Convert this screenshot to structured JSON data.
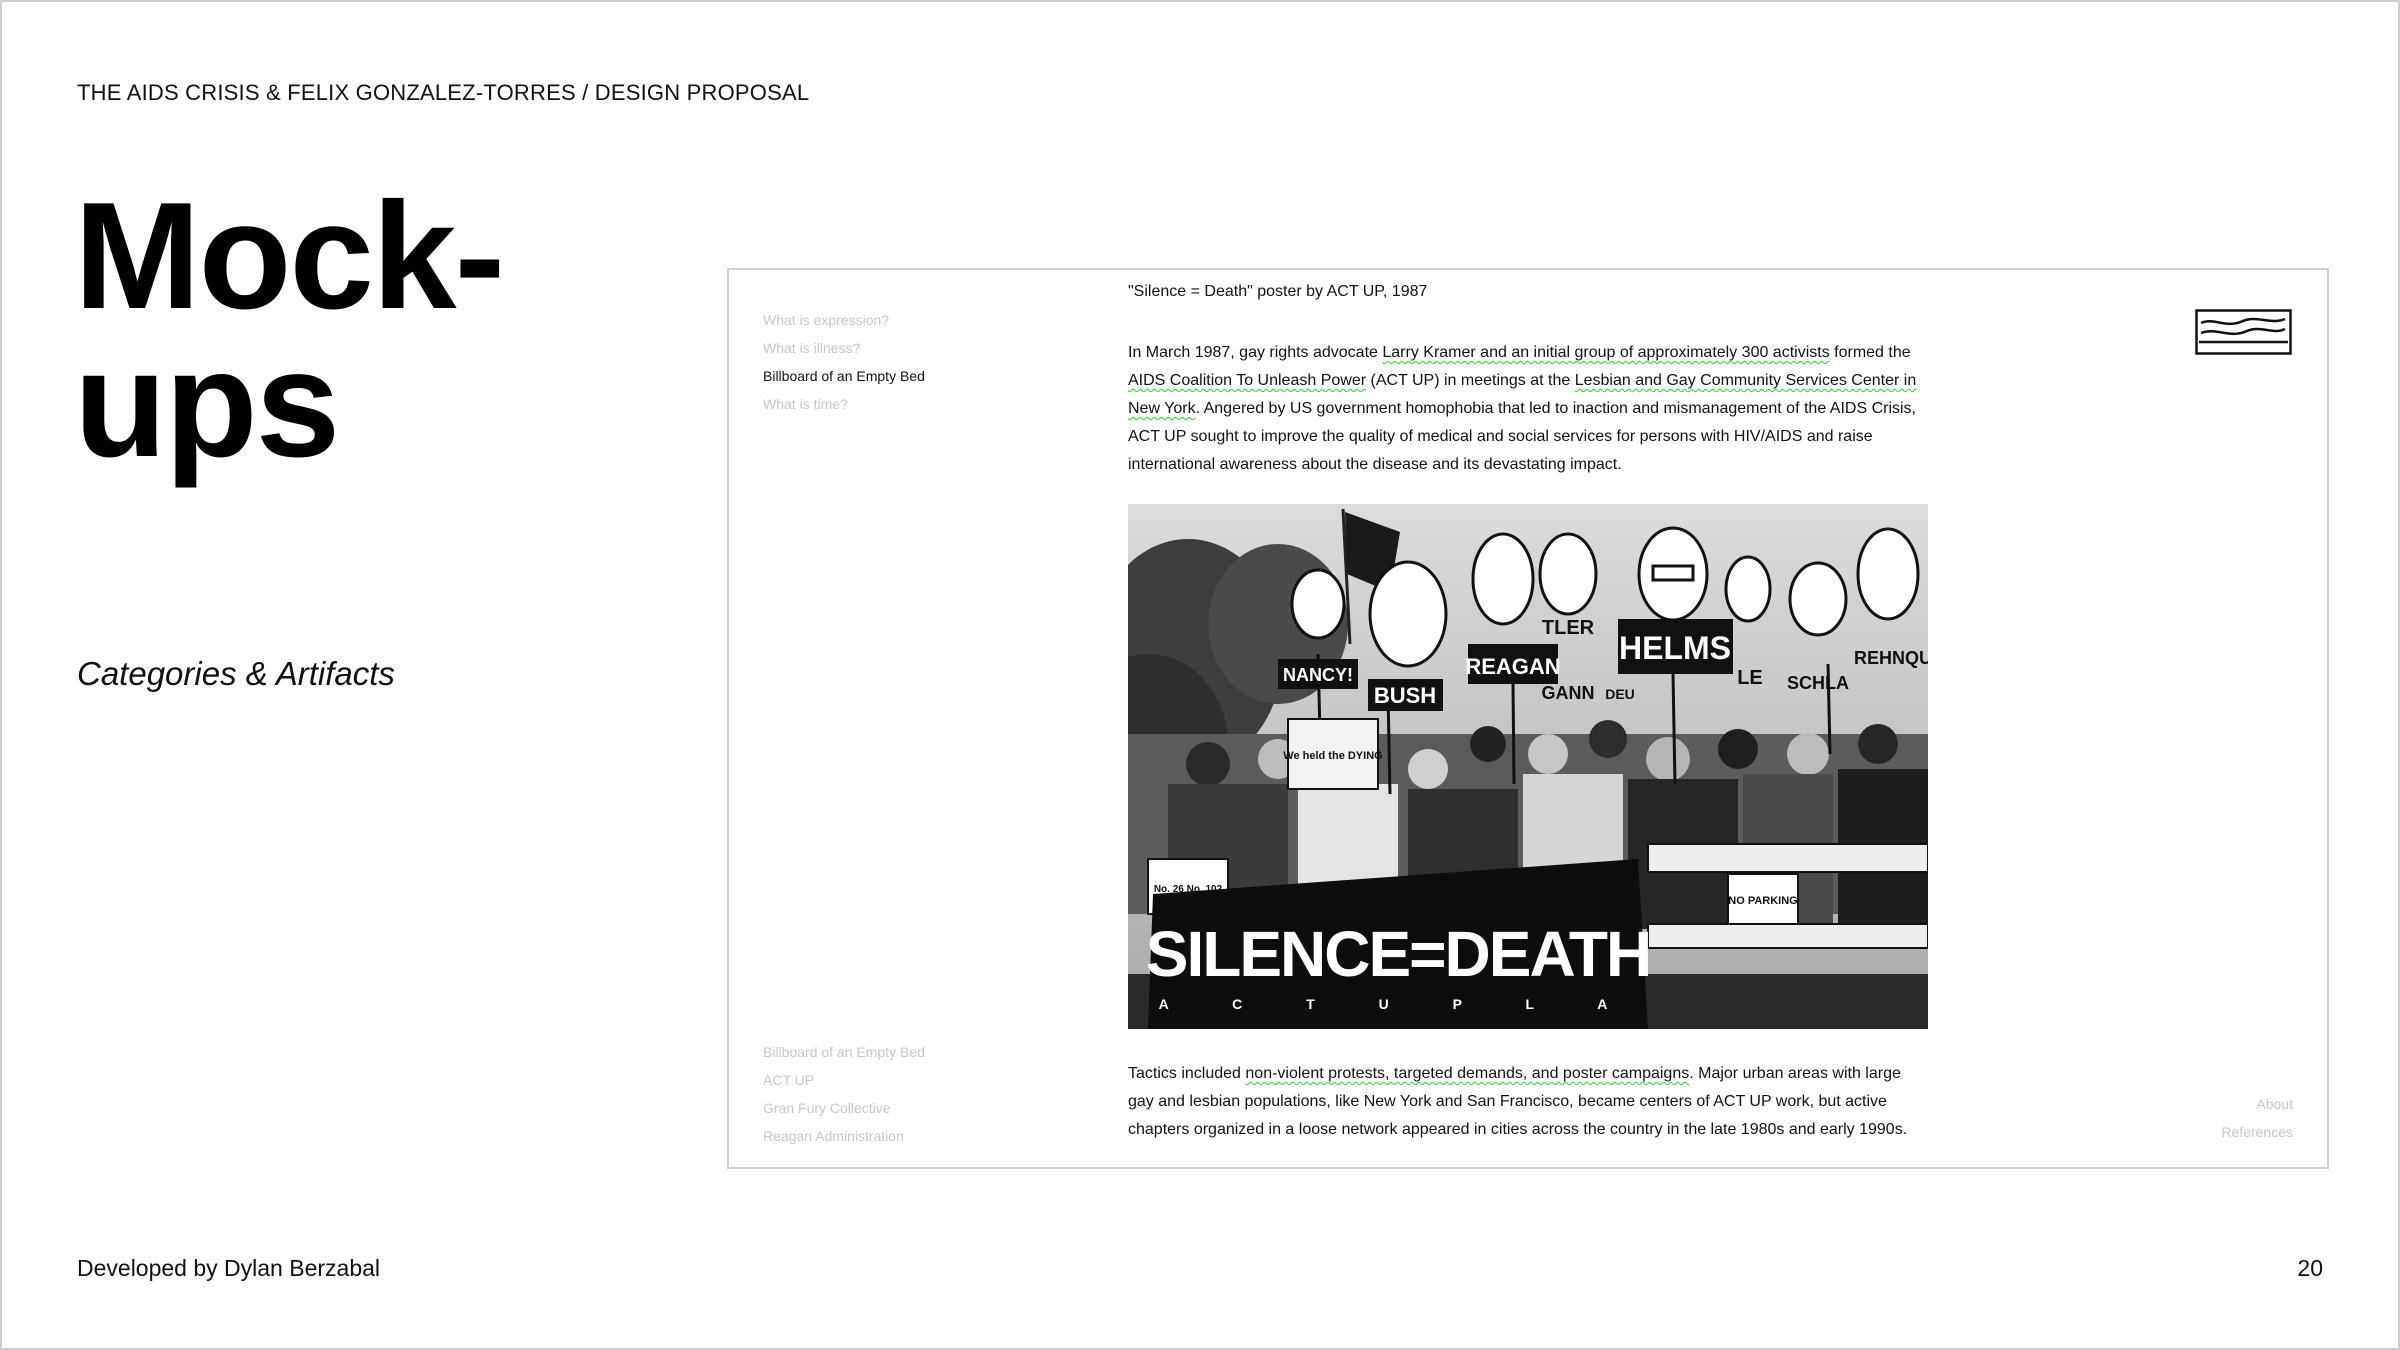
{
  "slide": {
    "header": "THE AIDS CRISIS & FELIX GONZALEZ-TORRES / DESIGN PROPOSAL",
    "title_line1": "Mock-",
    "title_line2": "ups",
    "subtitle": "Categories & Artifacts",
    "footer_left": "Developed by Dylan Berzabal",
    "page_number": "20"
  },
  "mockup": {
    "nav_top": [
      {
        "label": "What is expression?",
        "active": false
      },
      {
        "label": "What is illness?",
        "active": false
      },
      {
        "label": "Billboard of an Empty Bed",
        "active": true
      },
      {
        "label": "What is time?",
        "active": false
      }
    ],
    "nav_bottom": [
      "Billboard of an Empty Bed",
      "ACT UP",
      "Gran Fury Collective",
      "Reagan Administration"
    ],
    "nav_right": [
      "About",
      "References"
    ],
    "logo_icon": "empty-bed-logo-icon",
    "caption": "\"Silence = Death\" poster by ACT UP, 1987",
    "para1": {
      "t1": "In March 1987, gay rights advocate ",
      "s1": "Larry Kramer and an initial group of approximately 300 activists",
      "t2": " formed the ",
      "s2": "AIDS Coalition To Unleash Power",
      "t3": " (ACT UP) in meetings at the ",
      "s3": "Lesbian and Gay Community Services Center in New York",
      "t4": ". Angered by US government homophobia that led to inaction and mismanagement of the AIDS Crisis, ACT UP sought to improve the quality of medical and social services for persons with HIV/AIDS and raise international awareness about the disease and its devastating impact."
    },
    "photo": {
      "signs": [
        "NANCY!",
        "BUSH",
        "REAGAN",
        "TLER",
        "HELMS",
        "GANN",
        "DEU",
        "SCHLA",
        "REHNQU",
        "LE",
        "We held the DYING",
        "NO PARKING",
        "No. 26 No. 102"
      ],
      "banner_main": "SILENCE=DEATH",
      "banner_sub": "A C T U P L A"
    },
    "para2": {
      "t1": "Tactics included ",
      "s1": "non-violent protests, targeted demands, and poster campaigns",
      "t2": ". Major urban areas with large gay and lesbian populations, like New York and San Francisco, became centers of ACT UP work, but active chapters organized in a loose network appeared in cities across the country in the late 1980s and early 1990s."
    }
  }
}
